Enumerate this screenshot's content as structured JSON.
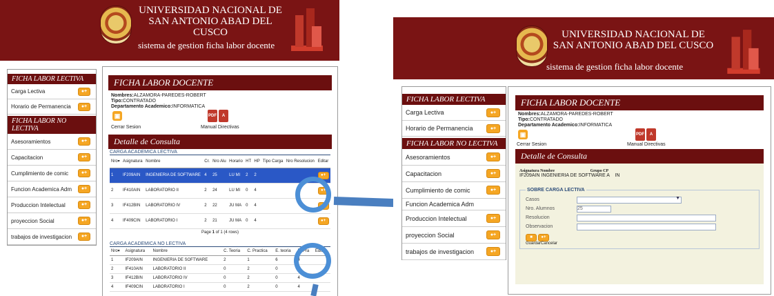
{
  "university": {
    "line1": "UNIVERSIDAD NACIONAL DE",
    "line2": "SAN ANTONIO ABAD DEL CUSCO",
    "subtitle": "sistema de gestion ficha labor docente"
  },
  "sidebar": {
    "header_lectiva": "FICHA LABOR LECTIVA",
    "header_no_lectiva": "FICHA LABOR NO LECTIVA",
    "lectiva_items": [
      "Carga Lectiva",
      "Horario de Permanencia"
    ],
    "no_lectiva_items": [
      "Asesoramientos",
      "Capacitacion",
      "Cumplimiento de comic",
      "Funcion Academica Adm",
      "Produccion Intelectual",
      "proyeccion Social",
      "trabajos de investigacion"
    ]
  },
  "ficha": {
    "title": "FICHA LABOR DOCENTE",
    "nombres_label": "Nombres:",
    "nombres": "ALZAMORA-PAREDES-ROBERT",
    "tipo_label": "Tipo:",
    "tipo": "CONTRATADO",
    "depto_label": "Departamento Academico:",
    "depto": "INFORMATICA",
    "cerrar": "Cerrar Sesion",
    "manual": "Manual Directivas"
  },
  "detalle": {
    "title": "Detalle de Consulta",
    "lectiva_caption": "CARGA ACADEMICA LECTIVA",
    "lectiva_headers": [
      "Nro",
      "Asignatura",
      "Nombre",
      "Cr.",
      "Nro Alu",
      "Horario",
      "HT",
      "HP",
      "Tipo Carga",
      "Nro Resolucion",
      "Editar"
    ],
    "lectiva_rows": [
      [
        "1",
        "IF209AIN",
        "INGENIERIA DE SOFTWARE",
        "4",
        "25",
        "LU MI",
        "2",
        "2",
        "",
        ""
      ],
      [
        "2",
        "IF410AIN",
        "LABORATORIO II",
        "2",
        "24",
        "LU MI",
        "0",
        "4",
        "",
        ""
      ],
      [
        "3",
        "IF412BIN",
        "LABORATORIO IV",
        "2",
        "22",
        "JU MA",
        "0",
        "4",
        "",
        ""
      ],
      [
        "4",
        "IF409CIN",
        "LABORATORIO I",
        "2",
        "21",
        "JU MA",
        "0",
        "4",
        "",
        ""
      ]
    ],
    "pager_prefix": "Page",
    "pager_page": "1",
    "pager_suffix": "of 1 (4 rows)",
    "no_lectiva_caption": "CARGA ACADEMICA NO LECTIVA",
    "no_lectiva_headers": [
      "Nro",
      "Asignatura",
      "Nombre",
      "C. Teoria",
      "C. Practica",
      "E. teoria",
      "E. Pra",
      "Editar"
    ],
    "no_lectiva_rows": [
      [
        "1",
        "IF209AIN",
        "INGENIERIA DE SOFTWARE",
        "2",
        "1",
        "6",
        "4"
      ],
      [
        "2",
        "IF410AIN",
        "LABORATORIO II",
        "0",
        "2",
        "0",
        "4"
      ],
      [
        "3",
        "IF412BIN",
        "LABORATORIO IV",
        "0",
        "2",
        "0",
        "4"
      ],
      [
        "4",
        "IF409CIN",
        "LABORATORIO I",
        "0",
        "2",
        "0",
        "4"
      ]
    ]
  },
  "detail_form": {
    "asig_label": "Asignatura",
    "nombre_label": "Nombre",
    "grupo_label": "Grupo",
    "cp_label": "CP",
    "asig_value": "IF209AIN",
    "nombre_value": "INGENIERIA DE SOFTWARE",
    "grupo_value": "A",
    "cp_value": "IN",
    "legend": "SOBRE CARGA LECTIVA",
    "casos_label": "Casos",
    "nro_alumnos_label": "Nro. Alumnos",
    "nro_alumnos_value": "25",
    "resolucion_label": "Resolucion",
    "observacion_label": "Observacion",
    "guardar": "Guardar",
    "cancelar": "Cancelar"
  },
  "colors": {
    "brand": "#7a1414",
    "selection": "#2a58c6",
    "annotation": "#4c8fd6",
    "button": "#f5a623"
  },
  "icons": [
    "lock-icon",
    "pdf-icon",
    "add-user-icon",
    "sort-icon",
    "dropdown-icon",
    "save-icon"
  ]
}
